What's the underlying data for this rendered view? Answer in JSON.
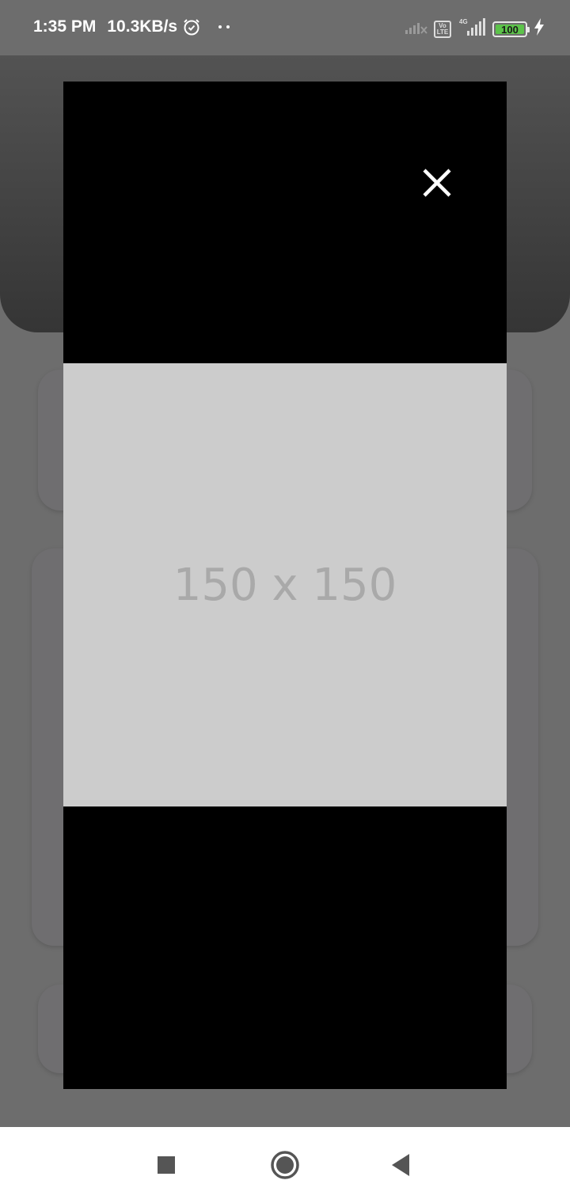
{
  "status_bar": {
    "time": "1:35 PM",
    "network_speed": "10.3KB/s",
    "alarm_icon": "alarm-clock-icon",
    "volte_label": "Vo LTE",
    "network_type": "4G",
    "battery_level": "100",
    "charging_icon": "lightning-bolt-icon"
  },
  "viewer": {
    "close_icon": "close-icon",
    "placeholder_text": "150 x 150"
  },
  "navigation_bar": {
    "recents_icon": "square-icon",
    "home_icon": "circle-icon",
    "back_icon": "triangle-back-icon"
  }
}
